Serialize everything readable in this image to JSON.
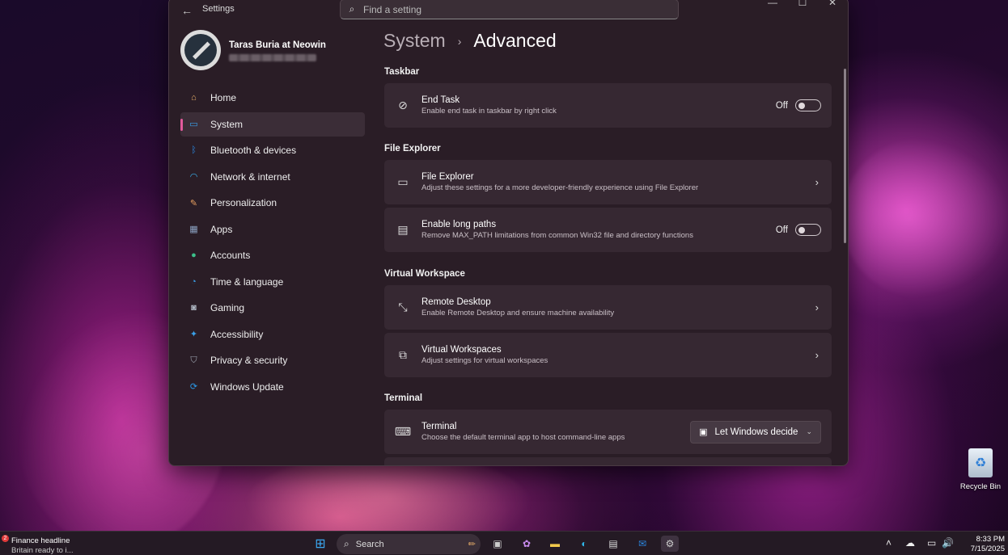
{
  "window": {
    "app_title": "Settings",
    "search_placeholder": "Find a setting",
    "minimize_glyph": "—",
    "maximize_glyph": "☐",
    "close_glyph": "✕"
  },
  "profile": {
    "name": "Taras Buria at Neowin"
  },
  "nav": {
    "items": [
      {
        "label": "Home",
        "icon": "home-icon",
        "glyph": "⌂",
        "color": "#e9b06a"
      },
      {
        "label": "System",
        "icon": "system-icon",
        "glyph": "▭",
        "color": "#3aa0e8"
      },
      {
        "label": "Bluetooth & devices",
        "icon": "bluetooth-icon",
        "glyph": "ᛒ",
        "color": "#2a86e0"
      },
      {
        "label": "Network & internet",
        "icon": "wifi-icon",
        "glyph": "◠",
        "color": "#3ab4f0"
      },
      {
        "label": "Personalization",
        "icon": "brush-icon",
        "glyph": "✎",
        "color": "#e9a060"
      },
      {
        "label": "Apps",
        "icon": "apps-icon",
        "glyph": "▦",
        "color": "#8aa0c0"
      },
      {
        "label": "Accounts",
        "icon": "accounts-icon",
        "glyph": "●",
        "color": "#3cc08a"
      },
      {
        "label": "Time & language",
        "icon": "globe-clock-icon",
        "glyph": "◔",
        "color": "#3aa0e8"
      },
      {
        "label": "Gaming",
        "icon": "gamepad-icon",
        "glyph": "◙",
        "color": "#b0b8c4"
      },
      {
        "label": "Accessibility",
        "icon": "accessibility-icon",
        "glyph": "✦",
        "color": "#3aa0e8"
      },
      {
        "label": "Privacy & security",
        "icon": "shield-icon",
        "glyph": "⛉",
        "color": "#a0a8b4"
      },
      {
        "label": "Windows Update",
        "icon": "update-icon",
        "glyph": "⟳",
        "color": "#2a9ae8"
      }
    ],
    "active_index": 1
  },
  "page": {
    "breadcrumb_parent": "System",
    "breadcrumb_sep": "›",
    "breadcrumb_current": "Advanced"
  },
  "sections": {
    "taskbar": {
      "title": "Taskbar",
      "end_task": {
        "title": "End Task",
        "desc": "Enable end task in taskbar by right click",
        "state": "Off",
        "icon": "end-task-icon",
        "glyph": "⊘"
      }
    },
    "file_explorer": {
      "title": "File Explorer",
      "file_explorer": {
        "title": "File Explorer",
        "desc": "Adjust these settings for a more developer-friendly experience using File Explorer",
        "icon": "folder-icon",
        "glyph": "▭"
      },
      "long_paths": {
        "title": "Enable long paths",
        "desc": "Remove MAX_PATH limitations from common Win32 file and directory functions",
        "state": "Off",
        "icon": "long-path-icon",
        "glyph": "▤"
      }
    },
    "virtual_workspace": {
      "title": "Virtual Workspace",
      "remote_desktop": {
        "title": "Remote Desktop",
        "desc": "Enable Remote Desktop and ensure machine availability",
        "icon": "remote-desktop-icon",
        "glyph": "⤡"
      },
      "virtual_workspaces": {
        "title": "Virtual Workspaces",
        "desc": "Adjust settings for virtual workspaces",
        "icon": "virtual-workspace-icon",
        "glyph": "⧉"
      }
    },
    "terminal": {
      "title": "Terminal",
      "terminal": {
        "title": "Terminal",
        "desc": "Choose the default terminal app to host command-line apps",
        "icon": "terminal-icon",
        "glyph": "⌨",
        "dropdown_value": "Let Windows decide"
      }
    }
  },
  "chevron_glyph": "›",
  "dropdown_chevron_glyph": "⌄",
  "desktop": {
    "recycle_bin_label": "Recycle Bin"
  },
  "taskbar": {
    "news_badge": "2",
    "news_title": "Finance headline",
    "news_sub": "Britain ready to i...",
    "search_label": "Search",
    "clock_time": "8:33 PM",
    "clock_date": "7/15/2025"
  }
}
